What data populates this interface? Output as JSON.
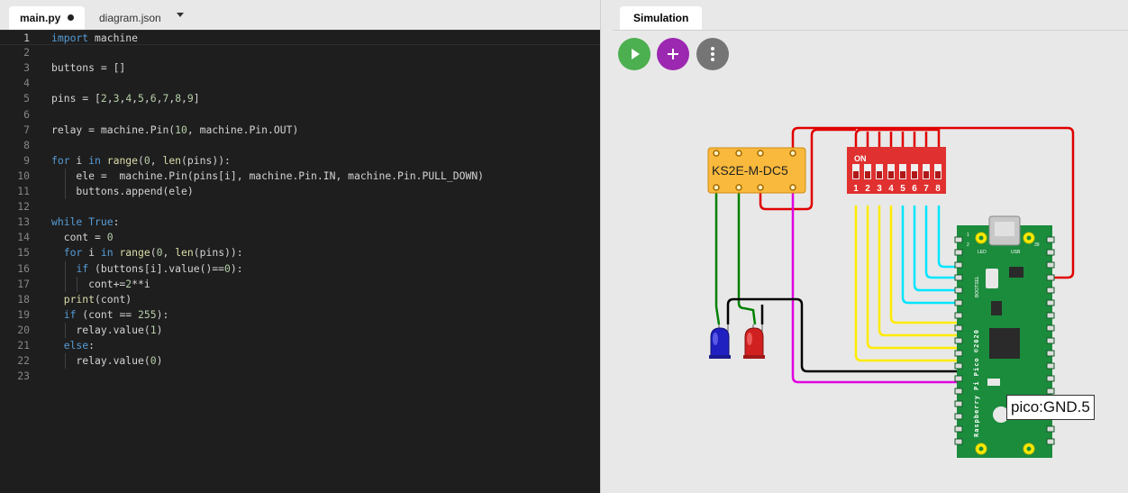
{
  "editor": {
    "tabs": [
      {
        "label": "main.py",
        "modified": true
      },
      {
        "label": "diagram.json",
        "modified": false
      }
    ],
    "lines": [
      {
        "num": "1",
        "text": "import machine"
      },
      {
        "num": "2",
        "text": ""
      },
      {
        "num": "3",
        "text": "buttons = []"
      },
      {
        "num": "4",
        "text": ""
      },
      {
        "num": "5",
        "text": "pins = [2,3,4,5,6,7,8,9]"
      },
      {
        "num": "6",
        "text": ""
      },
      {
        "num": "7",
        "text": "relay = machine.Pin(10, machine.Pin.OUT)"
      },
      {
        "num": "8",
        "text": ""
      },
      {
        "num": "9",
        "text": "for i in range(0, len(pins)):"
      },
      {
        "num": "10",
        "text": "    ele =  machine.Pin(pins[i], machine.Pin.IN, machine.Pin.PULL_DOWN)"
      },
      {
        "num": "11",
        "text": "    buttons.append(ele)"
      },
      {
        "num": "12",
        "text": ""
      },
      {
        "num": "13",
        "text": "while True:"
      },
      {
        "num": "14",
        "text": "  cont = 0"
      },
      {
        "num": "15",
        "text": "  for i in range(0, len(pins)):"
      },
      {
        "num": "16",
        "text": "    if (buttons[i].value()==0):"
      },
      {
        "num": "17",
        "text": "      cont+=2**i"
      },
      {
        "num": "18",
        "text": "  print(cont)"
      },
      {
        "num": "19",
        "text": "  if (cont == 255):"
      },
      {
        "num": "20",
        "text": "    relay.value(1)"
      },
      {
        "num": "21",
        "text": "  else:"
      },
      {
        "num": "22",
        "text": "    relay.value(0)"
      },
      {
        "num": "23",
        "text": ""
      }
    ]
  },
  "simulation": {
    "tab_label": "Simulation",
    "buttons": [
      {
        "name": "play-icon",
        "color": "#4caf50"
      },
      {
        "name": "plus-icon",
        "color": "#9c27b0"
      },
      {
        "name": "more-vertical-icon",
        "color": "#757575"
      }
    ],
    "relay_label": "KS2E-M-DC5",
    "dip_switch": {
      "on_label": "ON",
      "numbers": [
        "1",
        "2",
        "3",
        "4",
        "5",
        "6",
        "7",
        "8"
      ]
    },
    "board": {
      "label": "Raspberry Pi Pico ©2020",
      "bootsel": "BOOTSEL",
      "led": "LED",
      "usb": "USB",
      "pin_left_top": "1",
      "pin_left_second": "2",
      "pin_right_top": "39"
    },
    "tooltip": "pico:GND.5",
    "colors": {
      "wire_red": "#e00000",
      "wire_yellow": "#ffeb00",
      "wire_cyan": "#00e5ff",
      "wire_magenta": "#e000e0",
      "wire_green": "#008000",
      "wire_black": "#000000",
      "pico_green": "#1b8c3c",
      "relay_orange": "#f9b93c",
      "dip_red": "#e03030",
      "led_blue": "#2020c0",
      "led_red": "#d02020"
    }
  }
}
